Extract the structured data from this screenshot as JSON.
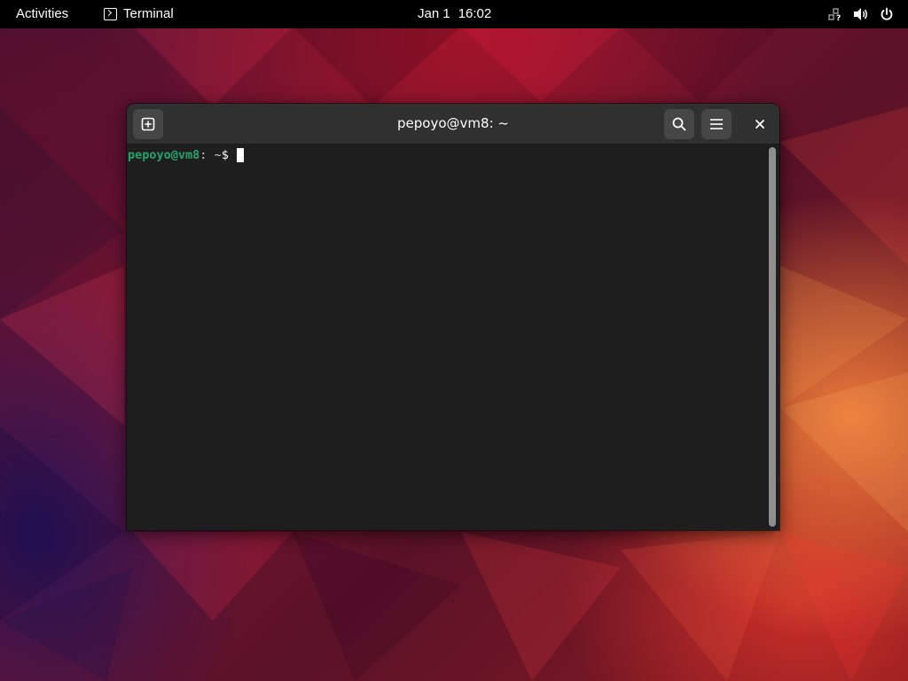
{
  "topbar": {
    "activities_label": "Activities",
    "app_name": "Terminal",
    "clock_date": "Jan 1",
    "clock_time": "16:02"
  },
  "window": {
    "title": "pepoyo@vm8: ~",
    "prompt": {
      "user_host": "pepoyo@vm8",
      "separator": ":",
      "path": " ~",
      "symbol": "$ "
    }
  },
  "icons": {
    "new_tab": "new-tab-icon",
    "search": "search-icon",
    "menu": "hamburger-menu-icon",
    "close": "close-icon",
    "network": "network-unknown-icon",
    "volume": "volume-icon",
    "power": "power-icon",
    "terminal": "terminal-icon"
  },
  "colors": {
    "topbar_bg": "#000000",
    "headerbar_bg": "#303030",
    "terminal_bg": "#1e1e1e",
    "prompt_user": "#26a269"
  }
}
